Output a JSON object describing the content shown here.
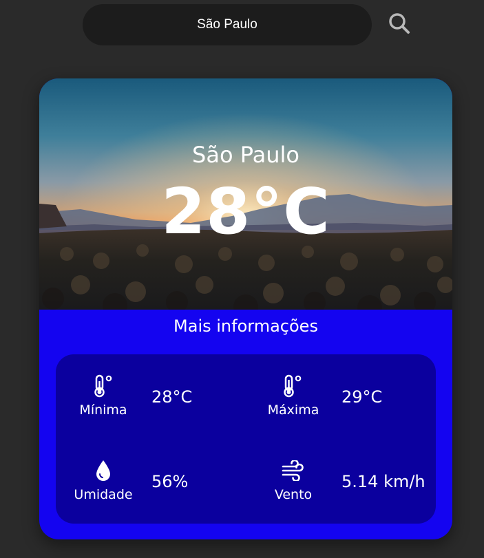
{
  "search": {
    "value": "São Paulo",
    "icon": "search-icon"
  },
  "weather": {
    "city": "São Paulo",
    "temperature": "28°C"
  },
  "more_info": {
    "title": "Mais informações",
    "min": {
      "label": "Mínima",
      "value": "28°C",
      "icon": "thermometer-icon"
    },
    "max": {
      "label": "Máxima",
      "value": "29°C",
      "icon": "thermometer-icon"
    },
    "humidity": {
      "label": "Umidade",
      "value": "56%",
      "icon": "droplet-icon"
    },
    "wind": {
      "label": "Vento",
      "value": "5.14 km/h",
      "icon": "wind-icon"
    }
  },
  "colors": {
    "background": "#2a2a2a",
    "search_bar": "#1c1c1c",
    "card_blue": "#1404f0",
    "details_panel": "#0b009e",
    "text": "#ffffff"
  }
}
